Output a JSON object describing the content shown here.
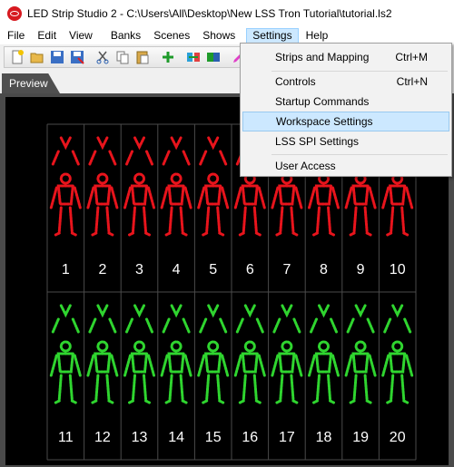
{
  "window": {
    "title": "LED Strip Studio 2 - C:\\Users\\All\\Desktop\\New LSS Tron Tutorial\\tutorial.ls2"
  },
  "menubar": {
    "items": [
      "File",
      "Edit",
      "View",
      "Banks",
      "Scenes",
      "Shows",
      "Settings",
      "Help"
    ],
    "active": "Settings"
  },
  "toolbar": {
    "buttons": [
      "new-icon",
      "open-icon",
      "save-icon",
      "save-as-icon",
      "cut-icon",
      "copy-icon",
      "paste-icon",
      "add-icon",
      "tool-icon",
      "tool2-icon",
      "pen-icon",
      "curve-icon"
    ]
  },
  "tabs": {
    "preview": "Preview"
  },
  "settings_menu": {
    "items": [
      {
        "label": "Strips and Mapping",
        "shortcut": "Ctrl+M"
      },
      {
        "label": "Controls",
        "shortcut": "Ctrl+N"
      },
      {
        "label": "Startup Commands",
        "shortcut": ""
      },
      {
        "label": "Workspace Settings",
        "shortcut": ""
      },
      {
        "label": "LSS SPI Settings",
        "shortcut": ""
      },
      {
        "label": "User Access",
        "shortcut": ""
      }
    ],
    "highlighted": "Workspace Settings"
  },
  "preview": {
    "top_row_labels": [
      "1",
      "2",
      "3",
      "4",
      "5",
      "6",
      "7",
      "8",
      "9",
      "10"
    ],
    "bottom_row_labels": [
      "11",
      "12",
      "13",
      "14",
      "15",
      "16",
      "17",
      "18",
      "19",
      "20"
    ],
    "top_color": "#e8141c",
    "bottom_color": "#2fd52f"
  }
}
